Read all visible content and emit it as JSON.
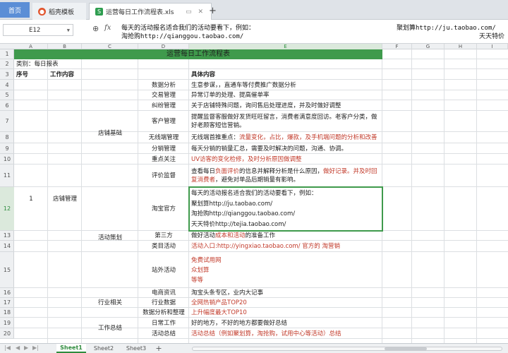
{
  "tabs": {
    "home": "首页",
    "template": "稻壳模板",
    "file": "运营每日工作流程表.xls",
    "new_tab": "+"
  },
  "formula_bar": {
    "cell_ref": "E12",
    "fx": "fx",
    "line1_a": "每天的活动报名适合我们的活动要看下，例如：",
    "line1_b": "聚划算http://ju.taobao.com/",
    "line2_a": "淘抢购http://qianggou.taobao.com/",
    "line2_b": "天天特价"
  },
  "columns": [
    "A",
    "B",
    "C",
    "D",
    "E",
    "F",
    "G",
    "H",
    "I"
  ],
  "rows": [
    "1",
    "2",
    "3",
    "4",
    "5",
    "6",
    "7",
    "8",
    "9",
    "10",
    "11",
    "12",
    "13",
    "14",
    "15",
    "16",
    "17",
    "18",
    "19",
    "20"
  ],
  "sheet": {
    "title": "运营每日工作流程表",
    "category": "类别：每日报表",
    "hdr_no": "序号",
    "hdr_content": "工作内容",
    "hdr_detail": "具体内容",
    "seq": "1",
    "main_cat": "店铺管理",
    "groups": {
      "store_basic": "店铺基础",
      "activity": "活动策划",
      "industry": "行业相关",
      "summary": "工作总结"
    },
    "items": {
      "r4": "数据分析",
      "r5": "交易管理",
      "r6": "纠纷管理",
      "r7": "客户管理",
      "r8": "无线端管理",
      "r9": "分销管理",
      "r10": "重点关注",
      "r11": "评价监督",
      "r12": "淘宝官方",
      "r13": "第三方",
      "r14": "类目活动",
      "r15": "站外活动",
      "r16": "电商资讯",
      "r17": "行业数据",
      "r18": "数据分析和整理",
      "r19": "日常工作",
      "r20": "活动总结"
    },
    "details": {
      "r4": "生意参谋，，直通车等付费推广数据分析",
      "r5": "异常订单的处理、提高催单率",
      "r6": "关于店铺特殊问题，询问售后处理进度，并及时做好调整",
      "r7a": "提醒监督客服做好发货旺旺留言，消费者满意度回访。老客户分类，做",
      "r7b": "好老顾客短信营销。",
      "r8_black": "无线端首推重点：",
      "r8_red": "流量变化，占比，爆款，及手机端问题的分析和改善",
      "r9": "每天分销的销量汇总，需要及时解决的问题，沟通、协调。",
      "r10": "UV访客的变化检修，及时分析原因做调整",
      "r11_a": "查看每日",
      "r11_b": "负面评价",
      "r11_c": "的信息并解释分析是什么原因，",
      "r11_d": "做好记录。并及时回",
      "r11_e": "复消费者",
      "r11_f": "，避免对单品后期销量有影响。",
      "r12_1": "每天的活动报名适合我们的活动要看下，例如：",
      "r12_2": "聚划算http://ju.taobao.com/",
      "r12_3": "淘抢购http://qianggou.taobao.com/",
      "r12_4": "天天特价http://tejia.taobao.com/",
      "r13_a": "做好活动",
      "r13_b": "成本和活动",
      "r13_c": "的准备工作",
      "r14": "活动入口:http://yingxiao.taobao.com/ 官方的 淘营销",
      "r15_1": "免费试用网",
      "r15_2": "众划算",
      "r15_3": "等等",
      "r16": "淘宝头条专区，业内大记事",
      "r17": "全网热销产品TOP20",
      "r18": "上升幅度最大TOP10",
      "r19": "好的地方，不好的地方都要做好总结",
      "r20": "活动总结（例如聚划算，淘抢购，试用中心等活动）总结"
    }
  },
  "sheets": [
    "Sheet1",
    "Sheet2",
    "Sheet3"
  ],
  "add_sheet": "+",
  "colors": {
    "title_bg": "#3f9a4c",
    "accent": "#2e8b3d",
    "red_text": "#c23a2a"
  }
}
